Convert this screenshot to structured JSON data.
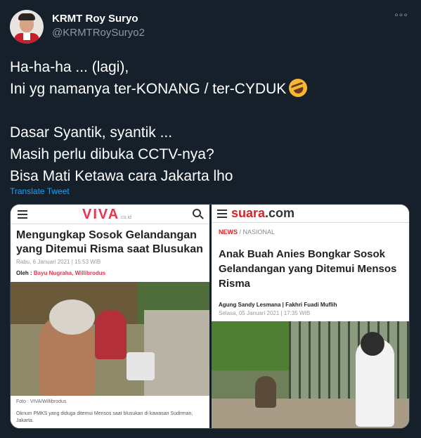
{
  "author": {
    "display_name": "KRMT Roy Suryo",
    "handle": "@KRMTRoySuryo2"
  },
  "more_icon": "°°°",
  "tweet": {
    "line1": "Ha-ha-ha ... (lagi),",
    "line2": "Ini yg namanya ter-KONANG / ter-CYDUK",
    "line2_emoji": "rolling-on-floor-laughing-emoji",
    "line3": "Dasar Syantik, syantik ...",
    "line4": "Masih perlu dibuka CCTV-nya?",
    "line5": "Bisa Mati Ketawa cara Jakarta lho"
  },
  "translate_label": "Translate Tweet",
  "viva": {
    "logo": "VIVA",
    "logo_suffix": ".co.id",
    "title": "Mengungkap Sosok Gelandangan yang Ditemui Risma saat Blusukan",
    "date": "Rabu, 6 Januari 2021 | 15:53 WIB",
    "author_prefix": "Oleh : ",
    "authors": "Bayu Nugraha,  Willibrodus",
    "photo_credit": "Foto :  VIVA/Willibrodus",
    "caption": "Oknum PMKS yang diduga ditemui Mensos saat blusukan di kawasan Sudirman, Jakarta."
  },
  "suara": {
    "logo_main": "suara",
    "logo_suffix": ".com",
    "category_news": "NEWS",
    "category_sep": " / ",
    "category_sub": "NASIONAL",
    "title": "Anak Buah Anies Bongkar Sosok Gelandangan yang Ditemui Mensos Risma",
    "authors": "Agung Sandy Lesmana | Fakhri Fuadi Muflih",
    "date": "Selasa, 05 Januari 2021 | 17:35 WIB"
  },
  "colors": {
    "background": "#15202b",
    "link": "#1da1f2",
    "muted": "#8899a6",
    "viva_brand": "#e8344e",
    "suara_brand": "#d8232a"
  }
}
